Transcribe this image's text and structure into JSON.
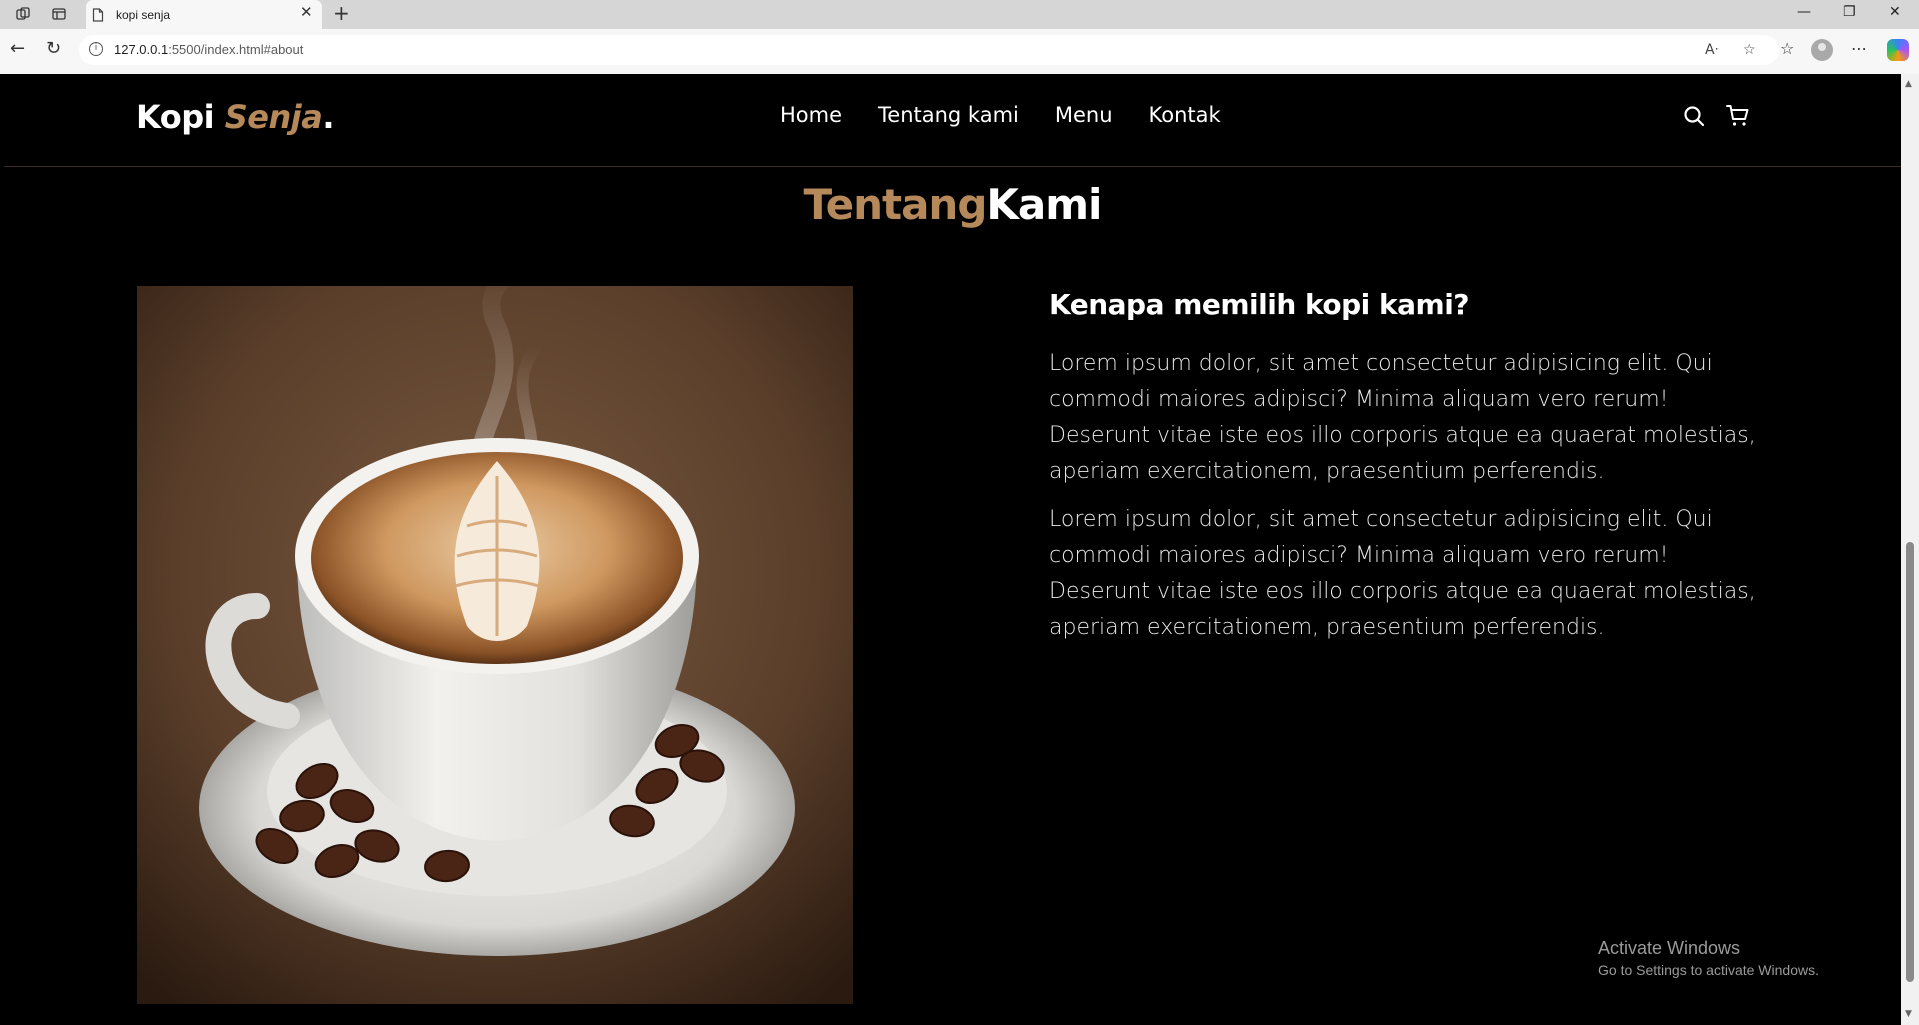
{
  "browser": {
    "tab_title": "kopi senja",
    "url_host": "127.0.0.1",
    "url_rest": ":5500/index.html#about",
    "new_tab_glyph": "+",
    "tab_close_glyph": "✕",
    "window_controls": {
      "minimize": "—",
      "restore": "❐",
      "close": "✕"
    }
  },
  "site": {
    "logo_main": "Kopi ",
    "logo_accent": "Senja",
    "logo_dot": ".",
    "accent_color": "#b6895b",
    "nav": [
      {
        "label": "Home"
      },
      {
        "label": "Tentang kami"
      },
      {
        "label": "Menu"
      },
      {
        "label": "Kontak"
      }
    ],
    "icons": [
      "search-icon",
      "shopping-cart-icon"
    ]
  },
  "about": {
    "title_accent": "Tentang",
    "title_main": "Kami",
    "heading": "Kenapa memilih kopi kami?",
    "paragraph1": "Lorem ipsum dolor, sit amet consectetur adipisicing elit. Qui commodi maiores adipisci? Minima aliquam vero rerum! Deserunt vitae iste eos illo corporis atque ea quaerat molestias, aperiam exercitationem, praesentium perferendis.",
    "paragraph2": "Lorem ipsum dolor, sit amet consectetur adipisicing elit. Qui commodi maiores adipisci? Minima aliquam vero rerum! Deserunt vitae iste eos illo corporis atque ea quaerat molestias, aperiam exercitationem, praesentium perferendis.",
    "image": "coffee-cup-latte-art"
  },
  "watermark": {
    "line1": "Activate Windows",
    "line2": "Go to Settings to activate Windows."
  }
}
